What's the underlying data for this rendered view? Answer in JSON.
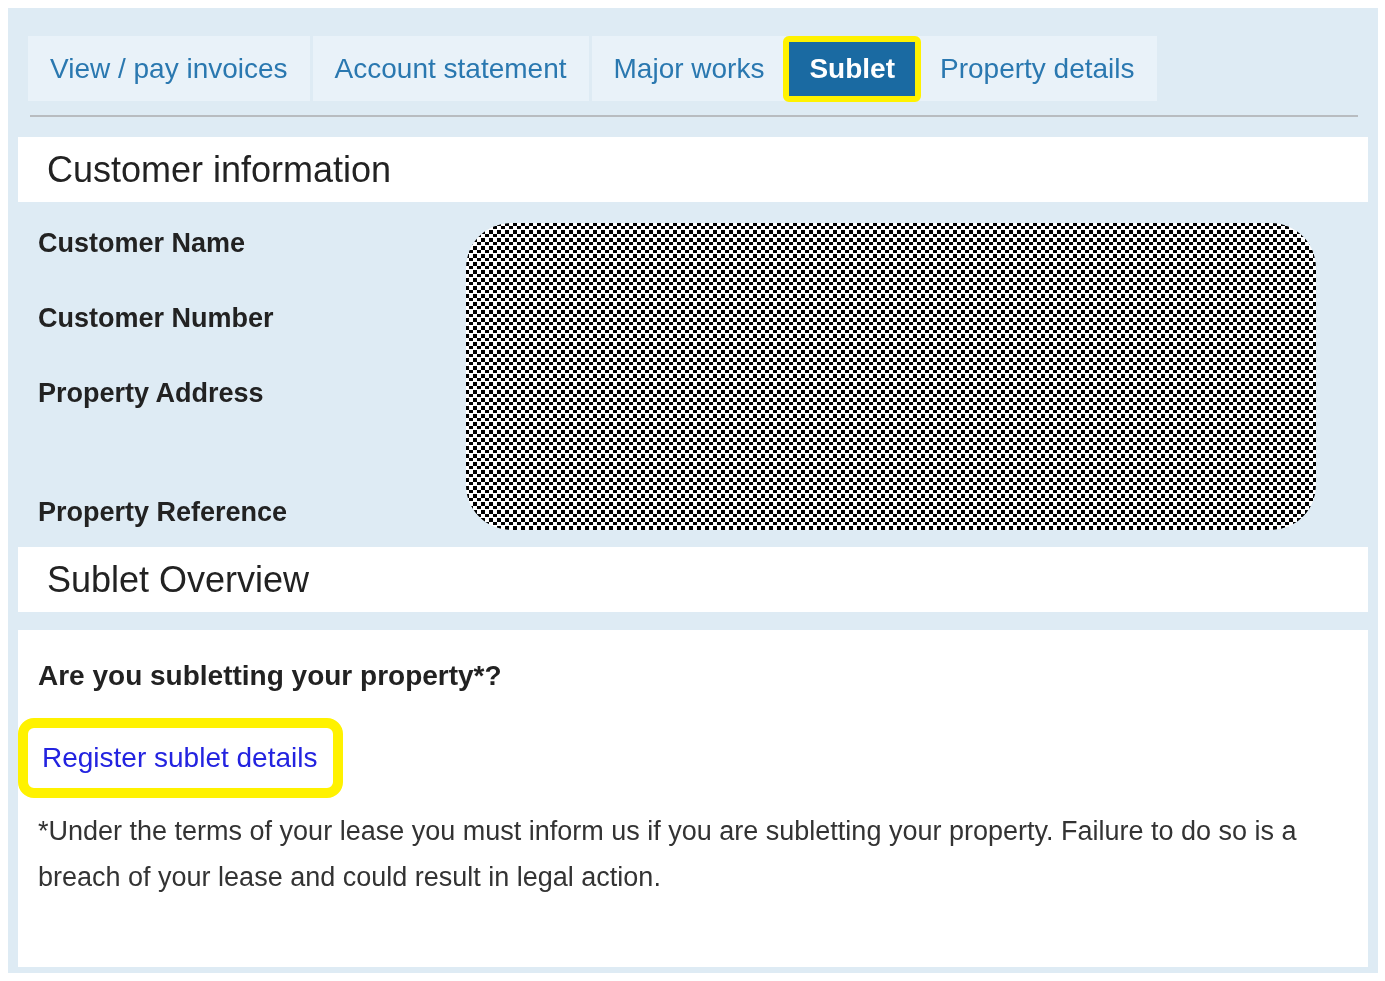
{
  "tabs": [
    {
      "label": "View / pay invoices",
      "selected": false,
      "highlighted": false
    },
    {
      "label": "Account statement",
      "selected": false,
      "highlighted": false
    },
    {
      "label": "Major works",
      "selected": false,
      "highlighted": false
    },
    {
      "label": "Sublet",
      "selected": true,
      "highlighted": true
    },
    {
      "label": "Property details",
      "selected": false,
      "highlighted": false
    }
  ],
  "customer_information": {
    "title": "Customer information",
    "redacted": true,
    "fields": [
      {
        "label": "Customer Name",
        "kind": "single"
      },
      {
        "label": "Customer Number",
        "kind": "single"
      },
      {
        "label": "Property Address",
        "kind": "tall"
      },
      {
        "label": "Property Reference",
        "kind": "single"
      }
    ]
  },
  "sublet_overview": {
    "title": "Sublet Overview",
    "question": "Are you subletting your property*?",
    "link": {
      "label": "Register sublet details",
      "highlighted": true
    },
    "note": "*Under the terms of your lease you must inform us if you are subletting your property. Failure to do so is a breach of your lease and could result in legal action."
  }
}
